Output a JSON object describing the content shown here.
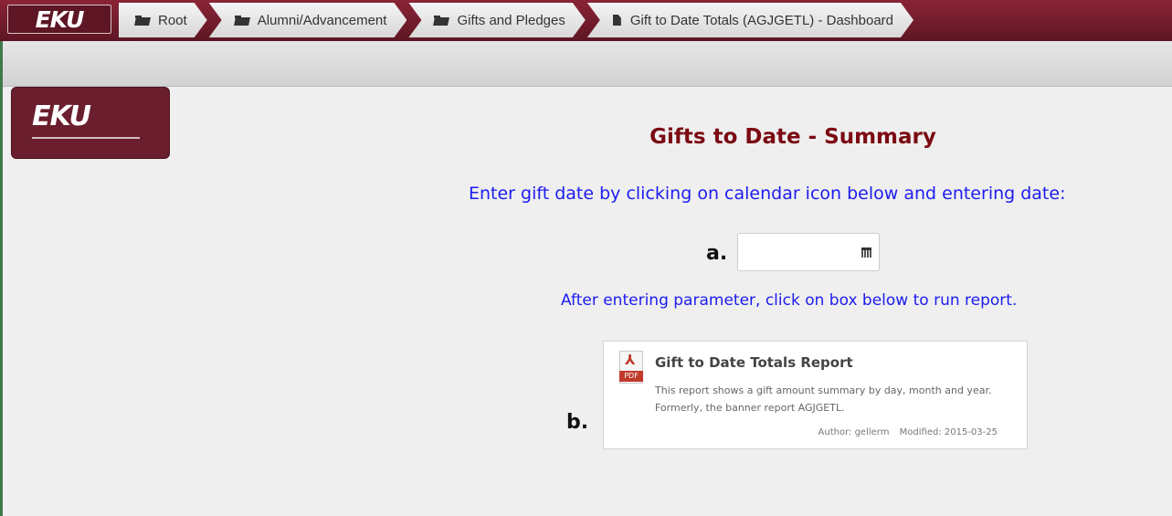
{
  "header": {
    "brand": "EKU",
    "crumbs": [
      {
        "label": "Root",
        "icon": "folder-icon"
      },
      {
        "label": "Alumni/Advancement",
        "icon": "folder-icon"
      },
      {
        "label": "Gifts and Pledges",
        "icon": "folder-icon"
      },
      {
        "label": "Gift to Date Totals (AGJGETL) - Dashboard",
        "icon": "file-icon"
      }
    ],
    "bar_color": "#6b1e2d"
  },
  "sidebar": {
    "logo_text": "EKU"
  },
  "main": {
    "title": "Gifts to Date - Summary",
    "instruction": "Enter gift date by clicking on calendar icon below and entering date:",
    "step_a": "a.",
    "date_value": "",
    "calendar_icon": "calendar-icon",
    "instruction2": "After entering parameter, click on box below to run report.",
    "step_b": "b.",
    "report": {
      "icon": "pdf-icon",
      "icon_label": "PDF",
      "title": "Gift to Date Totals Report",
      "description": "This report shows a gift amount summary by day, month and year. Formerly, the banner report AGJGETL.",
      "author": "Author: gellerm",
      "modified": "Modified: 2015-03-25"
    }
  },
  "colors": {
    "title": "#7b0a12",
    "instruction": "#1c1cf0",
    "frame": "#3f7a4a"
  }
}
